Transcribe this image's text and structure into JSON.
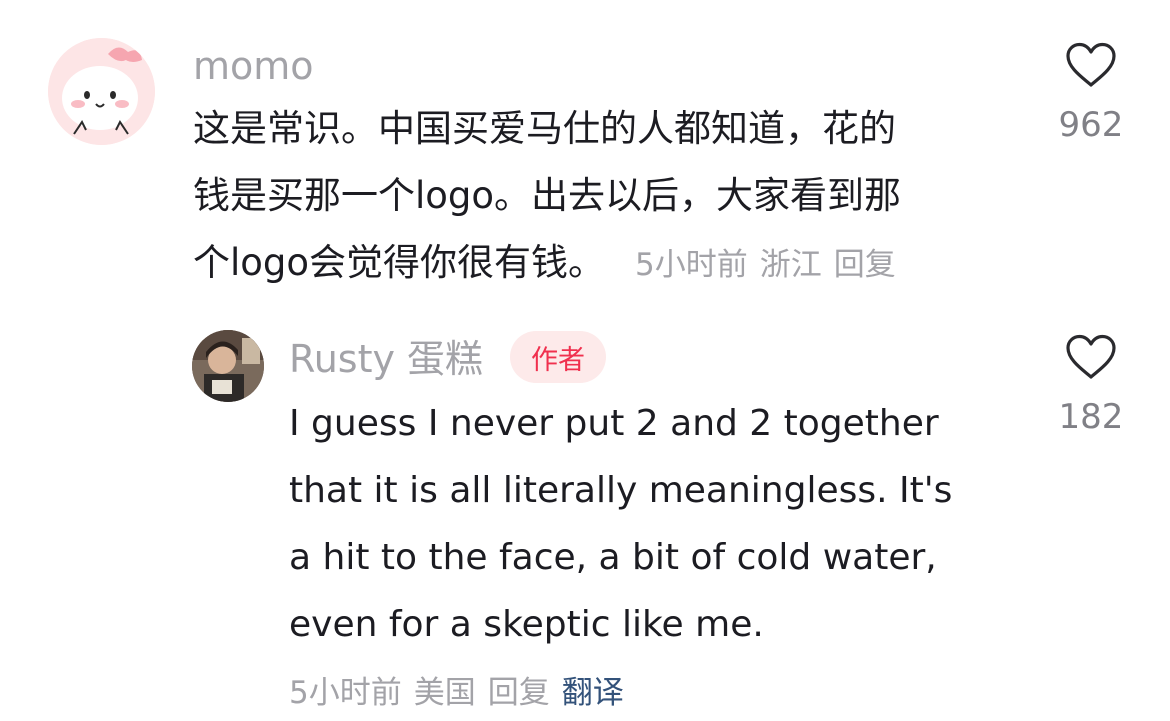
{
  "comments": [
    {
      "username": "momo",
      "lines": [
        "这是常识。中国买爱马仕的人都知道，花的",
        "钱是买那一个logo。出去以后，大家看到那",
        "个logo会觉得你很有钱。"
      ],
      "time": "5小时前",
      "location": "浙江",
      "reply_label": "回复",
      "likes": "962"
    },
    {
      "username": "Rusty 蛋糕",
      "badge": "作者",
      "lines": [
        "I guess I never put 2 and 2 together",
        "that it is all literally meaningless. It's",
        "a hit to the face, a bit of cold water,",
        "even for a skeptic like me."
      ],
      "time": "5小时前",
      "location": "美国",
      "reply_label": "回复",
      "translate_label": "翻译",
      "likes": "182"
    }
  ],
  "colors": {
    "badge_text": "#f0304e",
    "badge_bg": "#fdeaea",
    "translate_link": "#33527a",
    "meta_text": "#a3a3a8"
  },
  "icons": {
    "like": "heart-outline-icon"
  }
}
